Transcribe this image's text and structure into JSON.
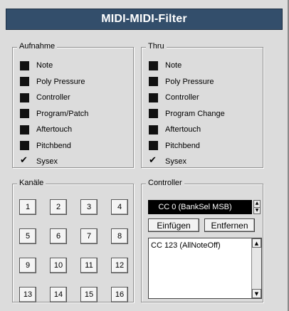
{
  "window": {
    "title": "MIDI-MIDI-Filter"
  },
  "record": {
    "title": "Aufnahme",
    "items": [
      {
        "label": "Note",
        "checked": false
      },
      {
        "label": "Poly Pressure",
        "checked": false
      },
      {
        "label": "Controller",
        "checked": false
      },
      {
        "label": "Program/Patch",
        "checked": false
      },
      {
        "label": "Aftertouch",
        "checked": false
      },
      {
        "label": "Pitchbend",
        "checked": false
      },
      {
        "label": "Sysex",
        "checked": true
      }
    ]
  },
  "thru": {
    "title": "Thru",
    "items": [
      {
        "label": "Note",
        "checked": false
      },
      {
        "label": "Poly Pressure",
        "checked": false
      },
      {
        "label": "Controller",
        "checked": false
      },
      {
        "label": "Program Change",
        "checked": false
      },
      {
        "label": "Aftertouch",
        "checked": false
      },
      {
        "label": "Pitchbend",
        "checked": false
      },
      {
        "label": "Sysex",
        "checked": true
      }
    ]
  },
  "channels": {
    "title": "Kanäle",
    "buttons": [
      "1",
      "2",
      "3",
      "4",
      "5",
      "6",
      "7",
      "8",
      "9",
      "10",
      "11",
      "12",
      "13",
      "14",
      "15",
      "16"
    ]
  },
  "controller": {
    "title": "Controller",
    "selected": "CC 0  (BankSel MSB)",
    "insert_label": "Einfügen",
    "remove_label": "Entfernen",
    "list": [
      "CC 123  (AllNoteOff)"
    ]
  }
}
